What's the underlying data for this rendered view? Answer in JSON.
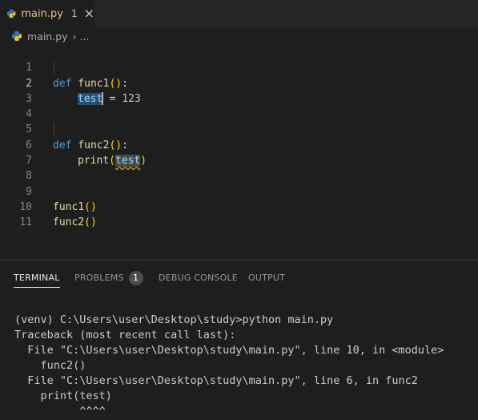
{
  "tab": {
    "filename": "main.py",
    "problems_count": "1",
    "close_symbol": "×"
  },
  "breadcrumb": {
    "file": "main.py",
    "separator": "›",
    "more": "..."
  },
  "editor": {
    "line_numbers": [
      "1",
      "2",
      "3",
      "4",
      "5",
      "6",
      "7",
      "8",
      "9",
      "10",
      "11"
    ],
    "active_line": "2",
    "code": {
      "l1": {
        "kw": "def",
        "name": "func1",
        "open": "(",
        "close": ")",
        "colon": ":"
      },
      "l2": {
        "var": "test",
        "op": " = ",
        "num": "123"
      },
      "l5": {
        "kw": "def",
        "name": "func2",
        "open": "(",
        "close": ")",
        "colon": ":"
      },
      "l6": {
        "fn": "print",
        "open": "(",
        "arg": "test",
        "close": ")"
      },
      "l9": {
        "fn": "func1",
        "parens": "()"
      },
      "l10": {
        "fn": "func2",
        "parens": "()"
      }
    }
  },
  "panel": {
    "tabs": [
      "TERMINAL",
      "PROBLEMS",
      "DEBUG CONSOLE",
      "OUTPUT"
    ],
    "active_tab": "TERMINAL",
    "problems_badge": "1"
  },
  "terminal": {
    "lines": [
      "(venv) C:\\Users\\user\\Desktop\\study>python main.py",
      "Traceback (most recent call last):",
      "  File \"C:\\Users\\user\\Desktop\\study\\main.py\", line 10, in <module>",
      "    func2()",
      "  File \"C:\\Users\\user\\Desktop\\study\\main.py\", line 6, in func2",
      "    print(test)",
      "          ^^^^"
    ]
  },
  "colors": {
    "background": "#1e1e1e",
    "keyword": "#569cd6",
    "function": "#dcdcaa",
    "bracket": "#ffd700",
    "variable": "#9cdcfe",
    "number": "#b5cea8",
    "modified_tab": "#e2c08d",
    "warning_squiggle": "#cca700"
  },
  "icons": {
    "python": "python-file-icon",
    "close": "close-icon",
    "chevron": "chevron-right-icon"
  }
}
